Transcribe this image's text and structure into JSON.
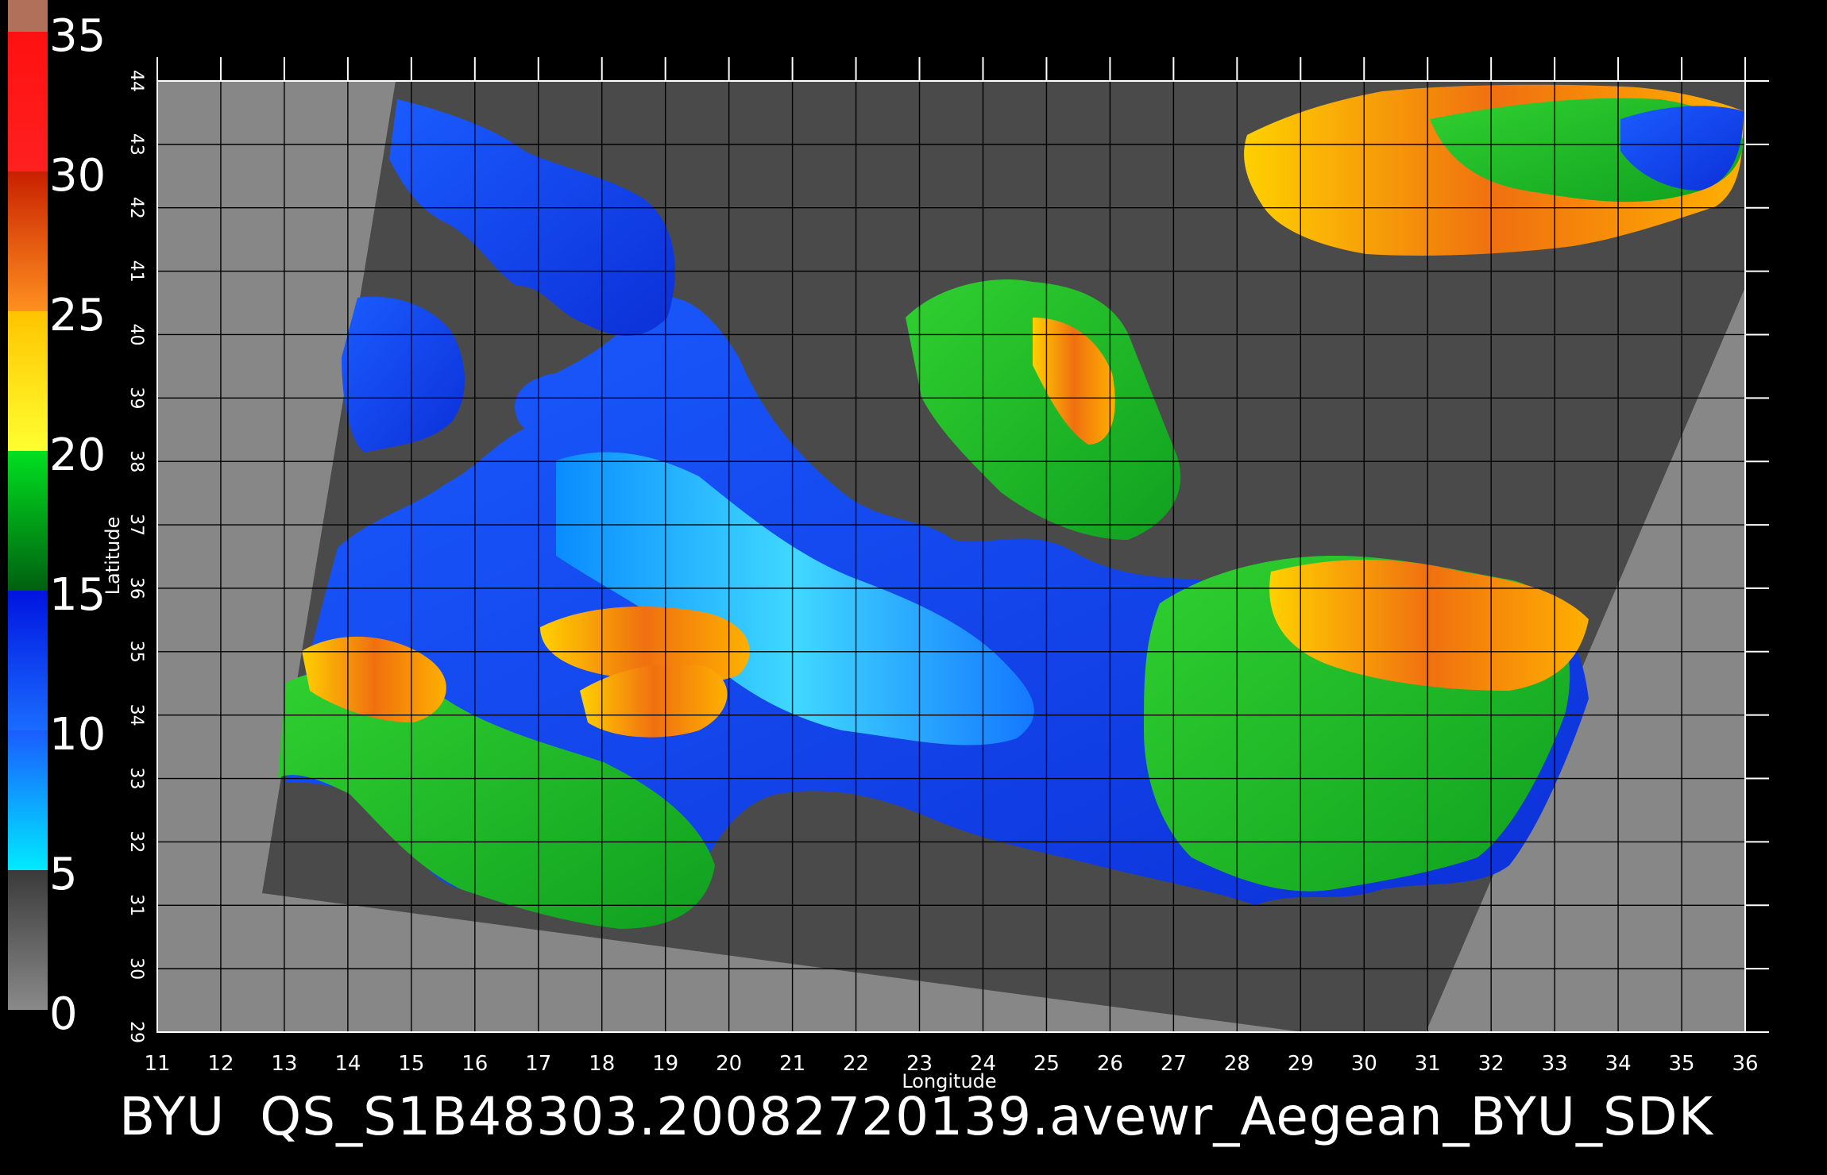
{
  "caption": {
    "org": "BYU",
    "product": "QS_S1B48303.20082720139.avewr_Aegean_BYU_SDK"
  },
  "axes": {
    "xlabel": "Longitude",
    "ylabel": "Latitude",
    "x_ticks": [
      "11",
      "12",
      "13",
      "14",
      "15",
      "16",
      "17",
      "18",
      "19",
      "20",
      "21",
      "22",
      "23",
      "24",
      "25",
      "26",
      "27",
      "28",
      "29",
      "30",
      "31",
      "32",
      "33",
      "34",
      "35",
      "36"
    ],
    "y_ticks": [
      "29",
      "30",
      "31",
      "32",
      "33",
      "34",
      "35",
      "36",
      "37",
      "38",
      "39",
      "40",
      "41",
      "42",
      "43",
      "44"
    ],
    "xlim": [
      11,
      36
    ],
    "ylim": [
      29,
      44
    ]
  },
  "colorbar": {
    "labels": [
      "0",
      "5",
      "10",
      "15",
      "20",
      "25",
      "30",
      "35"
    ],
    "range": [
      0,
      35
    ],
    "bands": [
      {
        "from": 0,
        "to": 5,
        "top": "#3a3a3a",
        "bottom": "#8a8a8a"
      },
      {
        "from": 5,
        "to": 10,
        "top": "#1a5cff",
        "bottom": "#00eaff"
      },
      {
        "from": 10,
        "to": 15,
        "top": "#0014e0",
        "bottom": "#1a6cff"
      },
      {
        "from": 15,
        "to": 20,
        "top": "#00e020",
        "bottom": "#006010"
      },
      {
        "from": 20,
        "to": 25,
        "top": "#ffc400",
        "bottom": "#ffff30"
      },
      {
        "from": 25,
        "to": 30,
        "top": "#c82000",
        "bottom": "#ff9020"
      },
      {
        "from": 30,
        "to": 35,
        "top": "#ff1010",
        "bottom": "#ff2020"
      }
    ],
    "cap_color": "#b0705a"
  },
  "colors": {
    "outside_swath": "#878787",
    "land": "#4a4a4a",
    "grid": "#000000",
    "sea_calm": "#1040f0",
    "sea_light": "#30c8ff",
    "sea_medium": "#20c020",
    "sea_strong": "#f0a020",
    "sea_peak": "#e84020"
  }
}
